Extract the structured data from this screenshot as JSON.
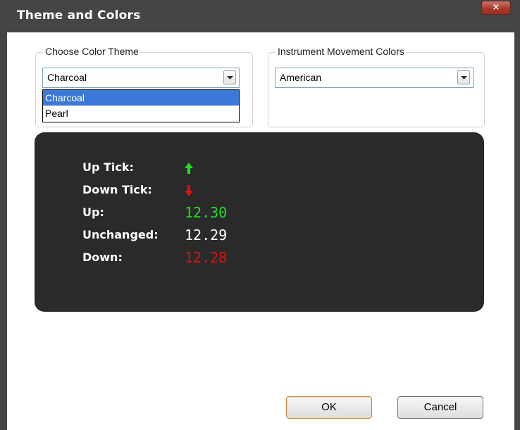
{
  "window": {
    "title": "Theme and Colors",
    "close_glyph": "×"
  },
  "color_theme": {
    "legend": "Choose Color Theme",
    "selected": "Charcoal",
    "options": [
      "Charcoal",
      "Pearl"
    ],
    "highlighted_option": "Charcoal"
  },
  "movement_colors": {
    "legend": "Instrument Movement Colors",
    "selected": "American"
  },
  "preview": {
    "up_tick_label": "Up Tick:",
    "down_tick_label": "Down Tick:",
    "up_label": "Up:",
    "up_value": "12.30",
    "unchanged_label": "Unchanged:",
    "unchanged_value": "12.29",
    "down_label": "Down:",
    "down_value": "12.28",
    "up_tick_icon": "arrow-up-icon",
    "down_tick_icon": "arrow-down-icon"
  },
  "buttons": {
    "ok_label": "OK",
    "cancel_label": "Cancel"
  },
  "colors": {
    "up": "#22dd22",
    "down": "#dd1111",
    "unchanged": "#ffffff",
    "preview_background": "#2a2a2a",
    "selection": "#3b78d7",
    "titlebar": "#454545"
  }
}
